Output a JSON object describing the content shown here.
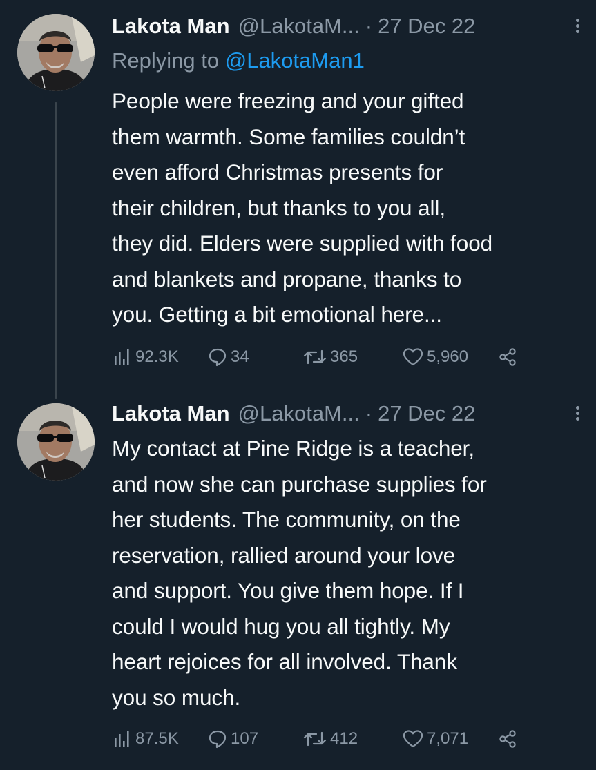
{
  "tweets": [
    {
      "author_name": "Lakota Man",
      "handle": "@LakotaM...",
      "separator": "·",
      "date": "27 Dec 22",
      "replying_prefix": "Replying to ",
      "replying_to": "@LakotaMan1",
      "text": "People were freezing and your gifted\nthem warmth. Some families couldn’t\neven afford Christmas presents for\ntheir children, but thanks to you all,\nthey did. Elders were supplied with food\nand blankets and propane, thanks to\nyou. Getting a bit emotional here...",
      "views": "92.3K",
      "replies": "34",
      "retweets": "365",
      "likes": "5,960"
    },
    {
      "author_name": "Lakota Man",
      "handle": "@LakotaM...",
      "separator": "·",
      "date": "27 Dec 22",
      "text": "My contact at Pine Ridge is a teacher,\nand now she can purchase supplies for\nher students. The community, on the\nreservation, rallied around your love\nand support. You give them hope. If I\ncould I would hug you all tightly. My\nheart rejoices for all involved. Thank\nyou so much.",
      "views": "87.5K",
      "replies": "107",
      "retweets": "412",
      "likes": "7,071"
    }
  ],
  "icons": {
    "views": "views-icon",
    "reply": "reply-icon",
    "retweet": "retweet-icon",
    "like": "heart-icon",
    "share": "share-icon",
    "more": "more-icon"
  },
  "colors": {
    "background": "#15202b",
    "text": "#f7f9f9",
    "secondary": "#8b98a5",
    "link": "#1d9bf0",
    "thread_line": "#3a444c"
  }
}
